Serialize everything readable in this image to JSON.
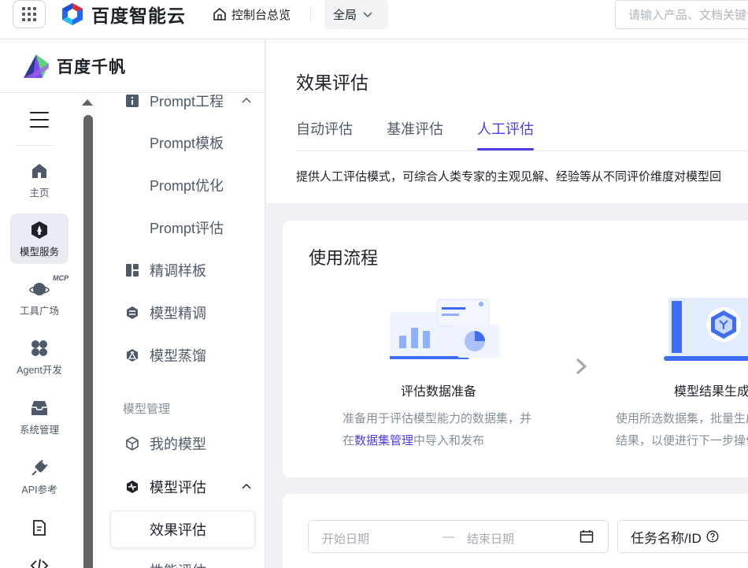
{
  "topbar": {
    "brand": "百度智能云",
    "console_label": "控制台总览",
    "scope": "全局",
    "search_placeholder": "请输入产品、文档关键词"
  },
  "sidebar_brand": "百度千帆",
  "rail": {
    "items": [
      {
        "label": "主页",
        "icon": "home-icon"
      },
      {
        "label": "模型服务",
        "icon": "model-service-icon",
        "active": true
      },
      {
        "label": "工具广场",
        "icon": "planet-icon",
        "badge": "MCP"
      },
      {
        "label": "Agent开发",
        "icon": "clover-icon"
      },
      {
        "label": "系统管理",
        "icon": "inbox-icon"
      },
      {
        "label": "API参考",
        "icon": "plug-icon"
      }
    ]
  },
  "nav": {
    "prompt_engineering": "Prompt工程",
    "prompt_template": "Prompt模板",
    "prompt_optimize": "Prompt优化",
    "prompt_evaluate": "Prompt评估",
    "finetune_templates": "精调样板",
    "model_finetune": "模型精调",
    "model_distill": "模型蒸馏",
    "section_model_mgmt": "模型管理",
    "my_models": "我的模型",
    "model_evaluation": "模型评估",
    "effect_evaluation": "效果评估",
    "performance_evaluation": "性能评估"
  },
  "main": {
    "title": "效果评估",
    "tabs": [
      "自动评估",
      "基准评估",
      "人工评估"
    ],
    "active_tab": 2,
    "description": "提供人工评估模式，可综合人类专家的主观见解、经验等从不同评价维度对模型回"
  },
  "process": {
    "title": "使用流程",
    "step1": {
      "name": "评估数据准备",
      "desc_line1": "准备用于评估模型能力的数据集，并",
      "desc_line2_pre": "在",
      "desc_link": "数据集管理",
      "desc_line2_post": "中导入和发布"
    },
    "step2": {
      "name": "模型结果生成",
      "desc_line1": "使用所选数据集，批量生成",
      "desc_line2": "结果，以便进行下一步操作"
    }
  },
  "filters": {
    "start_placeholder": "开始日期",
    "separator": "—",
    "end_placeholder": "结束日期",
    "task_label": "任务名称/ID"
  },
  "colors": {
    "accent": "#4b3ee4",
    "illustration_blue": "#3d6df5"
  }
}
